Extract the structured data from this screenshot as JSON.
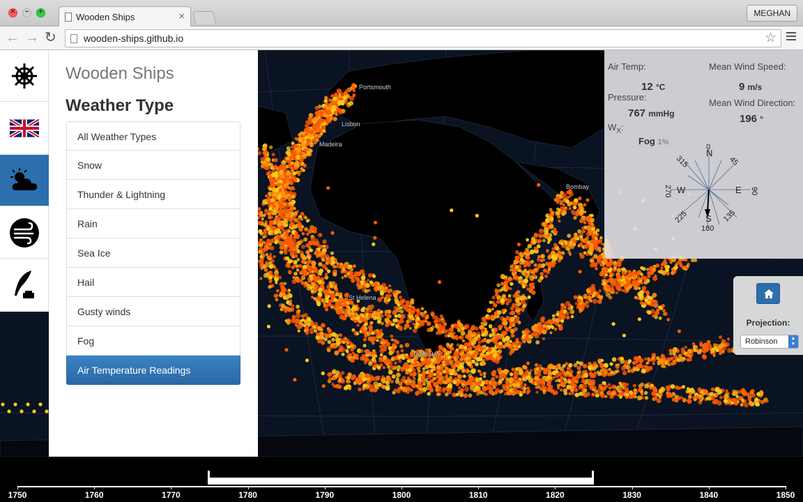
{
  "browser": {
    "tab_title": "Wooden Ships",
    "tab_close": "×",
    "url": "wooden-ships.github.io",
    "user": "MEGHAN",
    "traffic": {
      "close": "×",
      "min": "–",
      "max": "+"
    },
    "nav": {
      "back": "←",
      "forward": "→",
      "reload": "↻",
      "star": "☆"
    }
  },
  "map": {
    "labels": {
      "portsmouth": "Portsmouth",
      "lisbon": "Lisbon",
      "madeira": "Madeira",
      "bombay": "Bombay",
      "st_helena": "St Helena",
      "table_bay": "Table Bay"
    },
    "colors": {
      "ocean": "#0a1322",
      "land": "#000000",
      "high": "#ffcc1a",
      "low": "#ff5a00"
    }
  },
  "rail": {
    "items": [
      {
        "name": "ship-wheel-icon"
      },
      {
        "name": "union-jack-icon"
      },
      {
        "name": "weather-icon",
        "active": true
      },
      {
        "name": "wind-icon"
      },
      {
        "name": "quill-icon"
      }
    ]
  },
  "panel": {
    "app_title": "Wooden Ships",
    "section_title": "Weather Type",
    "weather_types": [
      "All Weather Types",
      "Snow",
      "Thunder & Lightning",
      "Rain",
      "Sea Ice",
      "Hail",
      "Gusty winds",
      "Fog",
      "Air Temperature Readings"
    ],
    "selected_index": 8
  },
  "info": {
    "air_temp_label": "Air Temp:",
    "air_temp_value": "12",
    "air_temp_unit": "°C",
    "pressure_label": "Pressure:",
    "pressure_value": "767",
    "pressure_unit": "mmHg",
    "wx_label": "W",
    "wx_sub": "X",
    "wx_colon": ":",
    "wx_value": "Fog",
    "wx_pct": "1%",
    "wind_speed_label": "Mean Wind Speed:",
    "wind_speed_value": "9",
    "wind_speed_unit": "m/s",
    "wind_dir_label": "Mean Wind Direction:",
    "wind_dir_value": "196",
    "wind_dir_unit": "°",
    "compass": {
      "n": "N",
      "s": "S",
      "e": "E",
      "w": "W",
      "deg_0": "0",
      "deg_45": "45",
      "deg_90": "90",
      "deg_135": "135",
      "deg_180": "180",
      "deg_225": "225",
      "deg_270": "270",
      "deg_315": "315"
    }
  },
  "controls": {
    "projection_label": "Projection:",
    "projection_value": "Robinson",
    "home_icon": "home-icon"
  },
  "timeline": {
    "years": [
      "1750",
      "1760",
      "1770",
      "1780",
      "1790",
      "1800",
      "1810",
      "1820",
      "1830",
      "1840",
      "1850"
    ],
    "selection": [
      1775,
      1825
    ]
  }
}
